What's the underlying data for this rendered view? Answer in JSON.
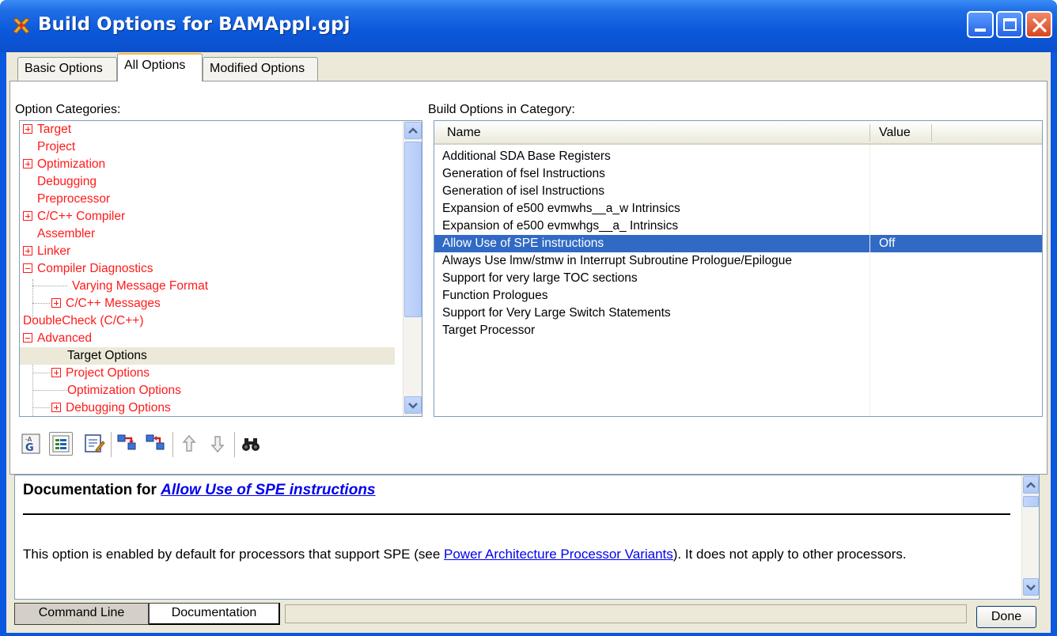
{
  "window": {
    "title": "Build Options for BAMAppl.gpj"
  },
  "tabs": [
    {
      "label": "Basic Options",
      "active": false
    },
    {
      "label": "All Options",
      "active": true
    },
    {
      "label": "Modified Options",
      "active": false
    }
  ],
  "categories_panel": {
    "label": "Option Categories:",
    "items": [
      {
        "label": "Target",
        "expander": "plus",
        "indent": 0,
        "color": "red"
      },
      {
        "label": "Project",
        "expander": "none",
        "indent": 0,
        "color": "red"
      },
      {
        "label": "Optimization",
        "expander": "plus",
        "indent": 0,
        "color": "red"
      },
      {
        "label": "Debugging",
        "expander": "none",
        "indent": 0,
        "color": "red"
      },
      {
        "label": "Preprocessor",
        "expander": "none",
        "indent": 0,
        "color": "red"
      },
      {
        "label": "C/C++ Compiler",
        "expander": "plus",
        "indent": 0,
        "color": "red"
      },
      {
        "label": "Assembler",
        "expander": "none",
        "indent": 0,
        "color": "red"
      },
      {
        "label": "Linker",
        "expander": "plus",
        "indent": 0,
        "color": "red"
      },
      {
        "label": "Compiler Diagnostics",
        "expander": "minus",
        "indent": 0,
        "color": "red"
      },
      {
        "label": "Varying Message Format",
        "expander": "none",
        "indent": 1,
        "color": "red"
      },
      {
        "label": "C/C++ Messages",
        "expander": "plus",
        "indent": 1,
        "color": "red"
      },
      {
        "label": "DoubleCheck (C/C++)",
        "expander": "none",
        "indent": 0,
        "color": "red"
      },
      {
        "label": "Advanced",
        "expander": "minus",
        "indent": 0,
        "color": "red"
      },
      {
        "label": "Target Options",
        "expander": "none",
        "indent": 1,
        "color": "black",
        "selected": true
      },
      {
        "label": "Project Options",
        "expander": "plus",
        "indent": 1,
        "color": "red"
      },
      {
        "label": "Optimization Options",
        "expander": "none",
        "indent": 1,
        "color": "red"
      },
      {
        "label": "Debugging Options",
        "expander": "plus",
        "indent": 1,
        "color": "red"
      }
    ]
  },
  "options_panel": {
    "label": "Build Options in Category:",
    "columns": [
      "Name",
      "Value"
    ],
    "rows": [
      {
        "name": "Additional SDA Base Registers",
        "value": ""
      },
      {
        "name": "Generation of fsel Instructions",
        "value": ""
      },
      {
        "name": "Generation of isel Instructions",
        "value": ""
      },
      {
        "name": "Expansion of e500 evmwhs__a_w Intrinsics",
        "value": ""
      },
      {
        "name": "Expansion of e500 evmwhgs__a_ Intrinsics",
        "value": ""
      },
      {
        "name": "Allow Use of SPE instructions",
        "value": "Off",
        "selected": true
      },
      {
        "name": "Always Use lmw/stmw in Interrupt Subroutine Prologue/Epilogue",
        "value": ""
      },
      {
        "name": "Support for very large TOC sections",
        "value": ""
      },
      {
        "name": "Function Prologues",
        "value": ""
      },
      {
        "name": "Support for Very Large Switch Statements",
        "value": ""
      },
      {
        "name": "Target Processor",
        "value": ""
      }
    ]
  },
  "toolbar": {
    "buttons": [
      "gnu-style-icon",
      "category-view-icon",
      "edit-options-icon",
      "expand-all-icon",
      "collapse-all-icon",
      "move-up-icon",
      "move-down-icon",
      "find-icon"
    ]
  },
  "documentation": {
    "heading_prefix": "Documentation for",
    "heading_link": "Allow Use of SPE instructions",
    "text_before": "This option is enabled by default for processors that support SPE (see ",
    "text_link": "Power Architecture Processor Variants",
    "text_after": "). It does not apply to other processors."
  },
  "bottom_tabs": [
    {
      "label": "Command Line",
      "active": false
    },
    {
      "label": "Documentation",
      "active": true
    }
  ],
  "done_label": "Done",
  "colors": {
    "titlebar": "#0b58da",
    "selection": "#316ac5",
    "modified_text": "#ff1a1a",
    "link": "#0000ee"
  }
}
